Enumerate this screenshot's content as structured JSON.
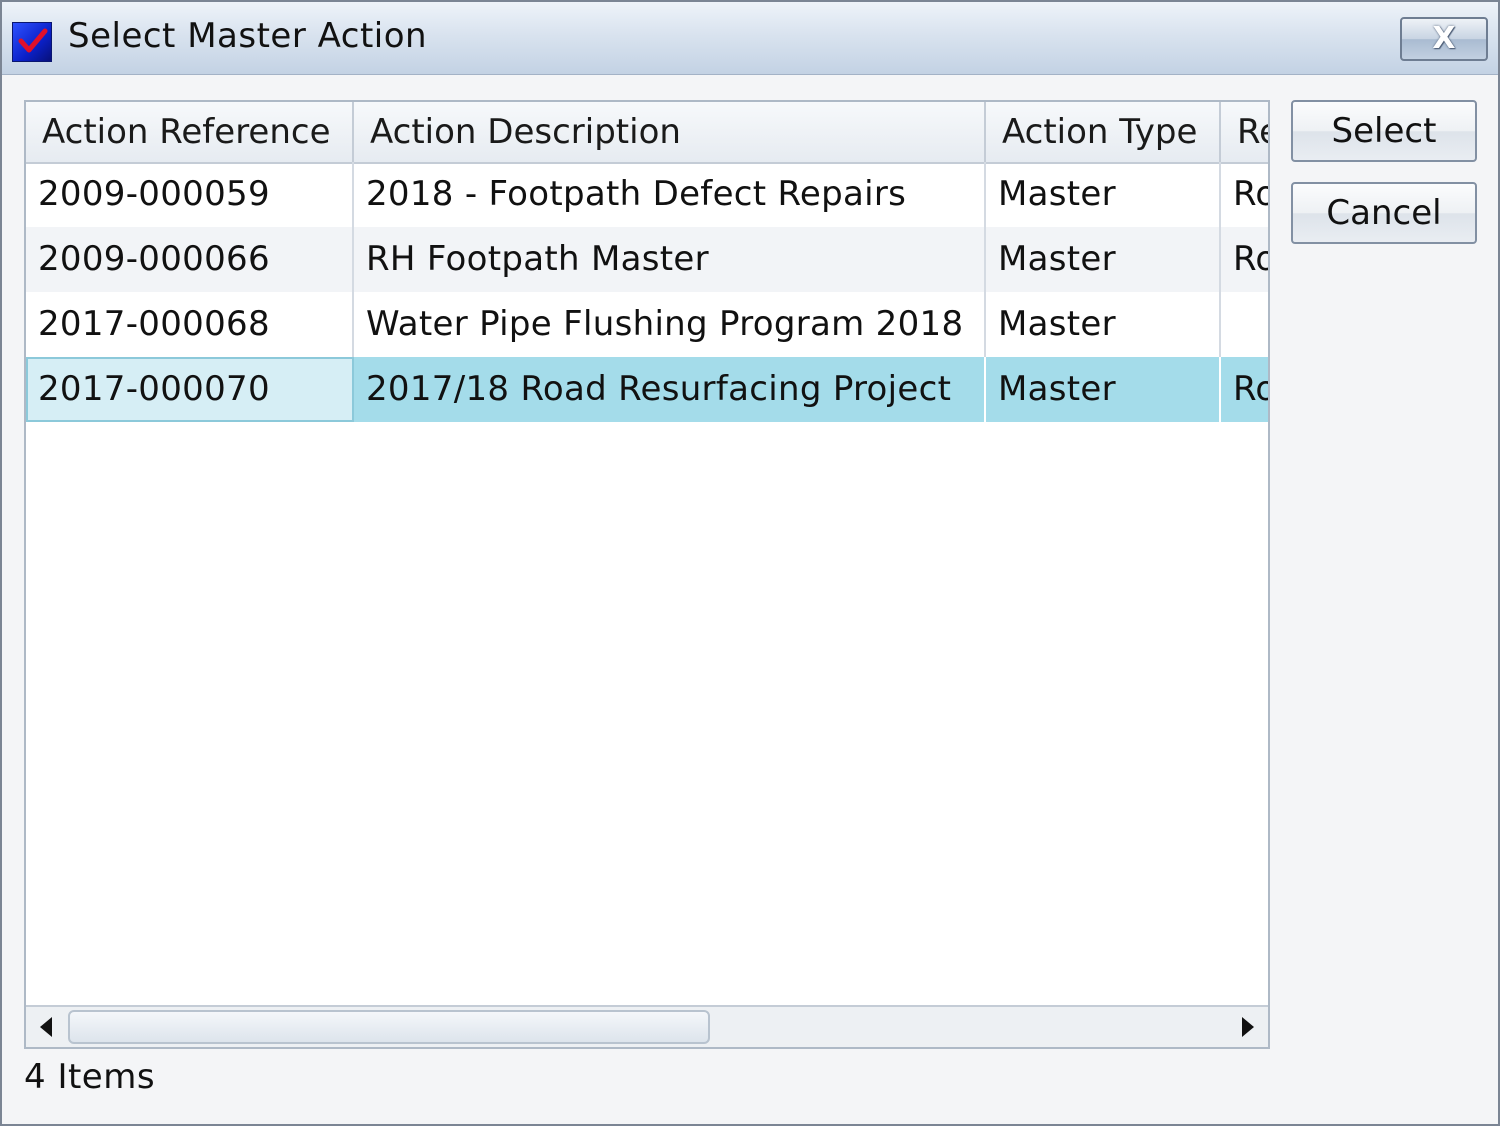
{
  "window": {
    "title": "Select Master Action",
    "close_label": "X"
  },
  "grid": {
    "columns": [
      {
        "label": "Action Reference"
      },
      {
        "label": "Action Description"
      },
      {
        "label": "Action Type"
      },
      {
        "label": "Re"
      }
    ],
    "rows": [
      {
        "reference": "2009-000059",
        "description": "2018 - Footpath Defect Repairs",
        "type": "Master",
        "extra": "Ro"
      },
      {
        "reference": "2009-000066",
        "description": "RH Footpath Master",
        "type": "Master",
        "extra": "Ro"
      },
      {
        "reference": "2017-000068",
        "description": "Water Pipe Flushing Program 2018",
        "type": "Master",
        "extra": ""
      },
      {
        "reference": "2017-000070",
        "description": "2017/18 Road Resurfacing Project",
        "type": "Master",
        "extra": "Ro"
      }
    ],
    "selected_row_index": 3
  },
  "status": {
    "item_count": "4 Items"
  },
  "buttons": {
    "select_label": "Select",
    "cancel_label": "Cancel"
  },
  "colors": {
    "selected_row": "#a4dcea",
    "title_icon": "#1a34e0"
  }
}
